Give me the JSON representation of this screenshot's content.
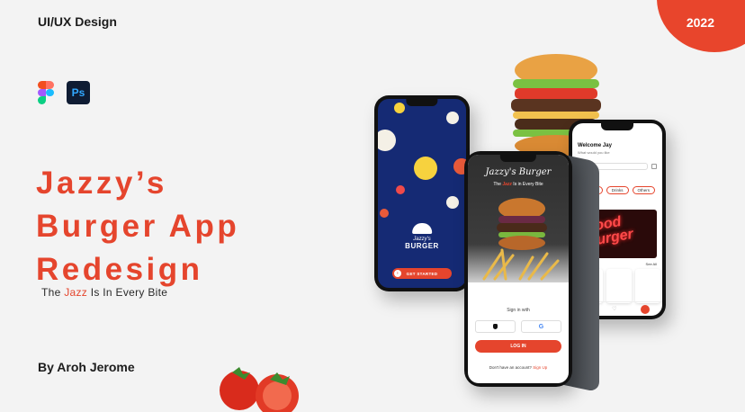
{
  "header": {
    "category": "UI/UX Design",
    "year": "2022"
  },
  "tools": [
    "figma-icon",
    "photoshop-icon"
  ],
  "photoshop_label": "Ps",
  "title": {
    "line1": "Jazzy’s",
    "line2": "Burger App",
    "line3": "Redesign"
  },
  "tagline": {
    "before": "The ",
    "accent": "Jazz",
    "after": " Is In Every Bite"
  },
  "author": "By Aroh Jerome",
  "colors": {
    "accent": "#e5452d",
    "background": "#f3f3f3",
    "splash": "#152a74"
  },
  "splash_screen": {
    "brand": "Jazzy's",
    "word": "BURGER",
    "button": "GET STARTED"
  },
  "signin_screen": {
    "script_title": "Jazzy's Burger",
    "subtitle_before": "The ",
    "subtitle_accent": "Jazz",
    "subtitle_after": " Is in Every Bite",
    "sign_in_with": "Sign in with",
    "google": "G",
    "apple": "",
    "login_button": "LOG IN",
    "signup_prompt": "Don't have an account?",
    "signup_link": "Sign Up"
  },
  "home_screen": {
    "greeting": "Welcome Jay",
    "sub": "What would you like",
    "chips": [
      "Burgers",
      "Drinks",
      "Others"
    ],
    "promo": "Good Burger",
    "see_all": "See All"
  }
}
